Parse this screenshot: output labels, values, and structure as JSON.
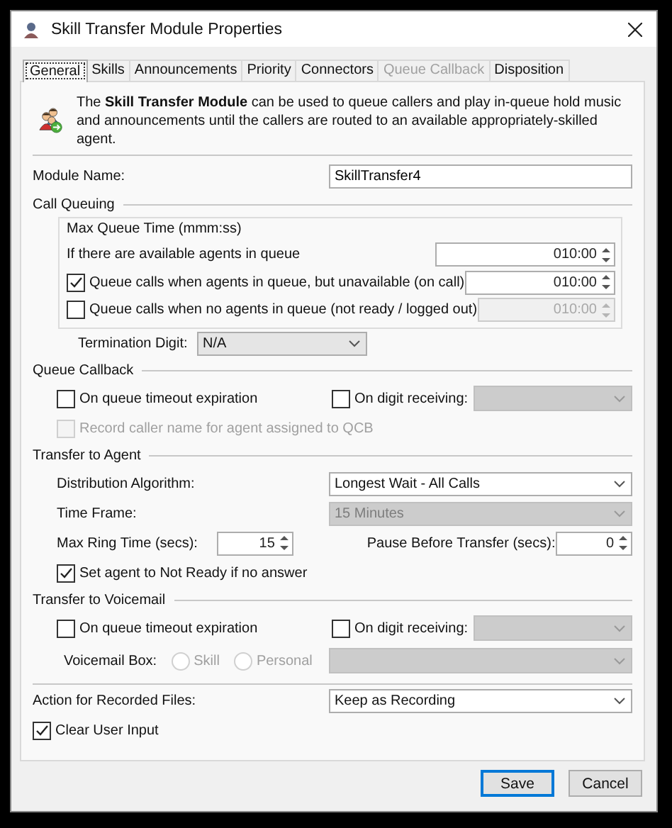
{
  "window": {
    "title": "Skill Transfer Module Properties"
  },
  "tabs": [
    {
      "label": "General",
      "selected": true,
      "disabled": false
    },
    {
      "label": "Skills",
      "selected": false,
      "disabled": false
    },
    {
      "label": "Announcements",
      "selected": false,
      "disabled": false
    },
    {
      "label": "Priority",
      "selected": false,
      "disabled": false
    },
    {
      "label": "Connectors",
      "selected": false,
      "disabled": false
    },
    {
      "label": "Queue Callback",
      "selected": false,
      "disabled": true
    },
    {
      "label": "Disposition",
      "selected": false,
      "disabled": false
    }
  ],
  "description": "The **Skill Transfer Module** can be used to queue callers and play in-queue hold music and announcements until the callers are routed to an available appropriately-skilled agent.",
  "module_name": {
    "label": "Module Name:",
    "value": "SkillTransfer4"
  },
  "call_queuing": {
    "title": "Call Queuing",
    "max_queue_time": {
      "title": "Max Queue Time (mmm:ss)",
      "rows": [
        {
          "kind": "label",
          "label": "If there are available agents in queue",
          "value": "010:00"
        },
        {
          "kind": "checkbox",
          "label": "Queue calls when agents in queue, but unavailable (on call)",
          "checked": true,
          "value": "010:00"
        },
        {
          "kind": "checkbox",
          "label": "Queue calls when no agents in queue (not ready / logged out)",
          "checked": false,
          "value": "010:00"
        }
      ]
    },
    "termination_digit": {
      "label": "Termination Digit:",
      "value": "N/A"
    }
  },
  "queue_callback": {
    "title": "Queue Callback",
    "on_timeout": {
      "label": "On queue timeout expiration",
      "checked": false
    },
    "on_digit": {
      "label": "On digit receiving:",
      "checked": false
    },
    "record_caller_name": {
      "label": "Record caller name for agent assigned to QCB",
      "checked": false,
      "disabled": true
    }
  },
  "transfer_to_agent": {
    "title": "Transfer to Agent",
    "distribution_algorithm": {
      "label": "Distribution Algorithm:",
      "value": "Longest Wait - All Calls"
    },
    "time_frame": {
      "label": "Time Frame:",
      "value": "15 Minutes",
      "disabled": true
    },
    "max_ring_time": {
      "label": "Max Ring Time (secs):",
      "value": "15"
    },
    "pause_before_transfer": {
      "label": "Pause Before Transfer (secs):",
      "value": "0"
    },
    "set_not_ready": {
      "label": "Set agent to Not Ready if no answer",
      "checked": true
    }
  },
  "transfer_to_voicemail": {
    "title": "Transfer to Voicemail",
    "on_timeout": {
      "label": "On queue timeout expiration",
      "checked": false
    },
    "on_digit": {
      "label": "On digit receiving:",
      "checked": false
    },
    "voicemail_box": {
      "label": "Voicemail Box:",
      "disabled": true,
      "options": [
        {
          "label": "Skill",
          "selected": false
        },
        {
          "label": "Personal",
          "selected": false
        }
      ]
    }
  },
  "action_for_recorded_files": {
    "label": "Action for Recorded Files:",
    "value": "Keep as Recording"
  },
  "clear_user_input": {
    "label": "Clear User Input",
    "checked": true
  },
  "buttons": [
    {
      "label": "Save",
      "default": true
    },
    {
      "label": "Cancel",
      "default": false
    }
  ]
}
